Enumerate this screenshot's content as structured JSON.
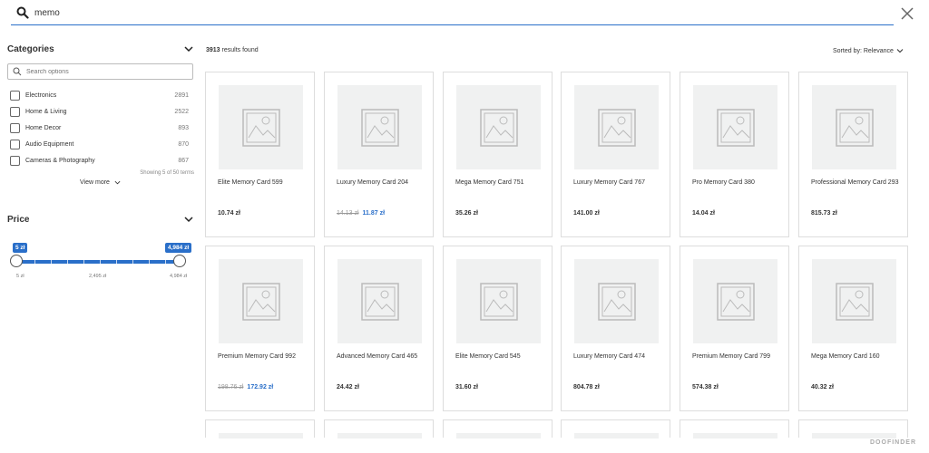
{
  "search": {
    "query": "memo"
  },
  "sidebar": {
    "categories": {
      "title": "Categories",
      "search_placeholder": "Search options",
      "items": [
        {
          "label": "Electronics",
          "count": "2891"
        },
        {
          "label": "Home & Living",
          "count": "2522"
        },
        {
          "label": "Home Decor",
          "count": "893"
        },
        {
          "label": "Audio Equipment",
          "count": "870"
        },
        {
          "label": "Cameras & Photography",
          "count": "867"
        }
      ],
      "showing": "Showing 5 of 50 terms",
      "view_more": "View more"
    },
    "price": {
      "title": "Price",
      "min_label": "5 zł",
      "max_label": "4,984 zł",
      "scale_min": "5 zł",
      "scale_mid": "2,495 zł",
      "scale_max": "4,984 zł"
    }
  },
  "results": {
    "count": "3913",
    "count_suffix": " results found",
    "sort_label": "Sorted by: Relevance",
    "products": [
      {
        "name": "Elite Memory Card 599",
        "price": "10.74 zł",
        "old_price": "",
        "sale_price": ""
      },
      {
        "name": "Luxury Memory Card 204",
        "price": "",
        "old_price": "14.13 zł",
        "sale_price": "11.87 zł"
      },
      {
        "name": "Mega Memory Card 751",
        "price": "35.26 zł",
        "old_price": "",
        "sale_price": ""
      },
      {
        "name": "Luxury Memory Card 767",
        "price": "141.00 zł",
        "old_price": "",
        "sale_price": ""
      },
      {
        "name": "Pro Memory Card 380",
        "price": "14.04 zł",
        "old_price": "",
        "sale_price": ""
      },
      {
        "name": "Professional Memory Card 293",
        "price": "815.73 zł",
        "old_price": "",
        "sale_price": ""
      },
      {
        "name": "Premium Memory Card 992",
        "price": "",
        "old_price": "198.76 zł",
        "sale_price": "172.92 zł"
      },
      {
        "name": "Advanced Memory Card 465",
        "price": "24.42 zł",
        "old_price": "",
        "sale_price": ""
      },
      {
        "name": "Elite Memory Card 545",
        "price": "31.60 zł",
        "old_price": "",
        "sale_price": ""
      },
      {
        "name": "Luxury Memory Card 474",
        "price": "804.78 zł",
        "old_price": "",
        "sale_price": ""
      },
      {
        "name": "Premium Memory Card 799",
        "price": "574.38 zł",
        "old_price": "",
        "sale_price": ""
      },
      {
        "name": "Mega Memory Card 160",
        "price": "40.32 zł",
        "old_price": "",
        "sale_price": ""
      }
    ]
  },
  "brand": "DOOFINDER",
  "colors": {
    "accent": "#2a6fc9",
    "border": "#dddddd",
    "placeholder_bg": "#f0f1f1"
  }
}
